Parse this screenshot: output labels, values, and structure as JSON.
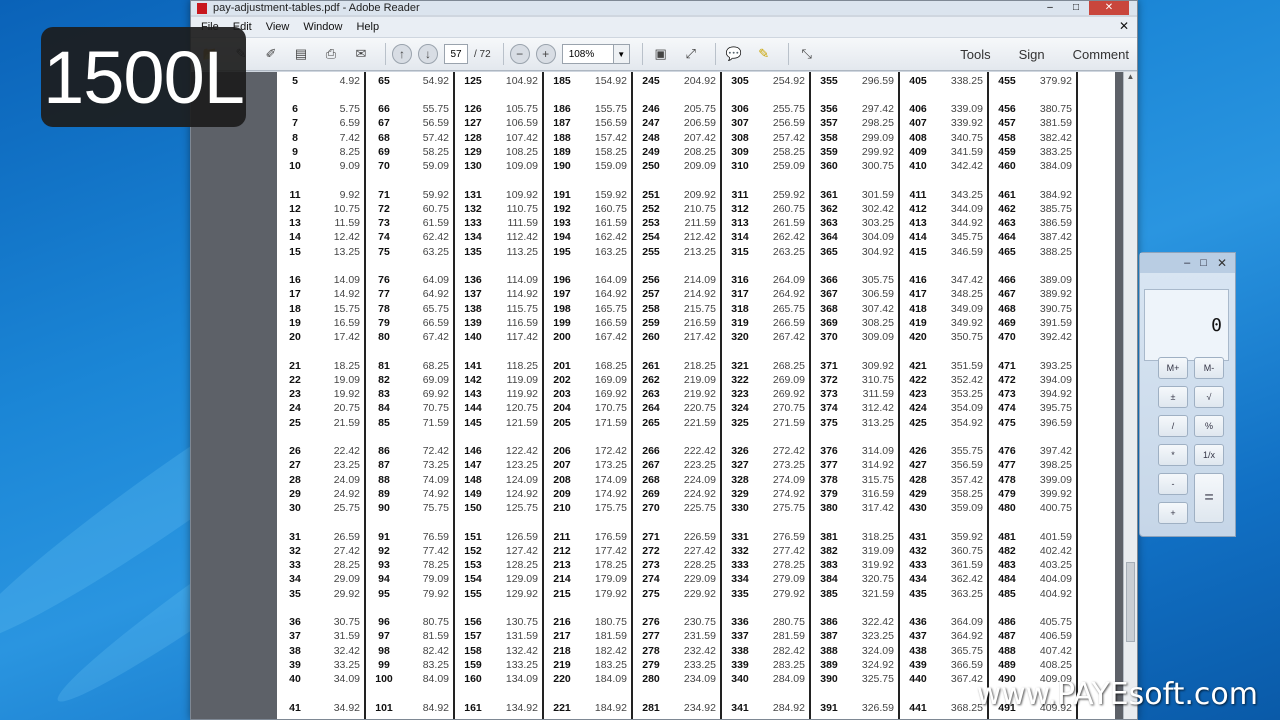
{
  "overlay": {
    "badge": "1500L",
    "watermark": "www.PAYEsoft.com"
  },
  "window": {
    "title": "pay-adjustment-tables.pdf - Adobe Reader"
  },
  "menu": [
    "File",
    "Edit",
    "View",
    "Window",
    "Help"
  ],
  "toolbar": {
    "page_current": "57",
    "page_total": "/ 72",
    "zoom": "108%",
    "right_buttons": [
      "Tools",
      "Sign",
      "Comment"
    ]
  },
  "table": {
    "columns": [
      [
        [
          "5",
          "4.92"
        ],
        [
          "6",
          "5.75"
        ],
        [
          "7",
          "6.59"
        ],
        [
          "8",
          "7.42"
        ],
        [
          "9",
          "8.25"
        ],
        [
          "10",
          "9.09"
        ],
        [
          "11",
          "9.92"
        ],
        [
          "12",
          "10.75"
        ],
        [
          "13",
          "11.59"
        ],
        [
          "14",
          "12.42"
        ],
        [
          "15",
          "13.25"
        ],
        [
          "16",
          "14.09"
        ],
        [
          "17",
          "14.92"
        ],
        [
          "18",
          "15.75"
        ],
        [
          "19",
          "16.59"
        ],
        [
          "20",
          "17.42"
        ],
        [
          "21",
          "18.25"
        ],
        [
          "22",
          "19.09"
        ],
        [
          "23",
          "19.92"
        ],
        [
          "24",
          "20.75"
        ],
        [
          "25",
          "21.59"
        ],
        [
          "26",
          "22.42"
        ],
        [
          "27",
          "23.25"
        ],
        [
          "28",
          "24.09"
        ],
        [
          "29",
          "24.92"
        ],
        [
          "30",
          "25.75"
        ],
        [
          "31",
          "26.59"
        ],
        [
          "32",
          "27.42"
        ],
        [
          "33",
          "28.25"
        ],
        [
          "34",
          "29.09"
        ],
        [
          "35",
          "29.92"
        ],
        [
          "36",
          "30.75"
        ],
        [
          "37",
          "31.59"
        ],
        [
          "38",
          "32.42"
        ],
        [
          "39",
          "33.25"
        ],
        [
          "40",
          "34.09"
        ],
        [
          "41",
          "34.92"
        ]
      ],
      [
        [
          "65",
          "54.92"
        ],
        [
          "66",
          "55.75"
        ],
        [
          "67",
          "56.59"
        ],
        [
          "68",
          "57.42"
        ],
        [
          "69",
          "58.25"
        ],
        [
          "70",
          "59.09"
        ],
        [
          "71",
          "59.92"
        ],
        [
          "72",
          "60.75"
        ],
        [
          "73",
          "61.59"
        ],
        [
          "74",
          "62.42"
        ],
        [
          "75",
          "63.25"
        ],
        [
          "76",
          "64.09"
        ],
        [
          "77",
          "64.92"
        ],
        [
          "78",
          "65.75"
        ],
        [
          "79",
          "66.59"
        ],
        [
          "80",
          "67.42"
        ],
        [
          "81",
          "68.25"
        ],
        [
          "82",
          "69.09"
        ],
        [
          "83",
          "69.92"
        ],
        [
          "84",
          "70.75"
        ],
        [
          "85",
          "71.59"
        ],
        [
          "86",
          "72.42"
        ],
        [
          "87",
          "73.25"
        ],
        [
          "88",
          "74.09"
        ],
        [
          "89",
          "74.92"
        ],
        [
          "90",
          "75.75"
        ],
        [
          "91",
          "76.59"
        ],
        [
          "92",
          "77.42"
        ],
        [
          "93",
          "78.25"
        ],
        [
          "94",
          "79.09"
        ],
        [
          "95",
          "79.92"
        ],
        [
          "96",
          "80.75"
        ],
        [
          "97",
          "81.59"
        ],
        [
          "98",
          "82.42"
        ],
        [
          "99",
          "83.25"
        ],
        [
          "100",
          "84.09"
        ],
        [
          "101",
          "84.92"
        ]
      ],
      [
        [
          "125",
          "104.92"
        ],
        [
          "126",
          "105.75"
        ],
        [
          "127",
          "106.59"
        ],
        [
          "128",
          "107.42"
        ],
        [
          "129",
          "108.25"
        ],
        [
          "130",
          "109.09"
        ],
        [
          "131",
          "109.92"
        ],
        [
          "132",
          "110.75"
        ],
        [
          "133",
          "111.59"
        ],
        [
          "134",
          "112.42"
        ],
        [
          "135",
          "113.25"
        ],
        [
          "136",
          "114.09"
        ],
        [
          "137",
          "114.92"
        ],
        [
          "138",
          "115.75"
        ],
        [
          "139",
          "116.59"
        ],
        [
          "140",
          "117.42"
        ],
        [
          "141",
          "118.25"
        ],
        [
          "142",
          "119.09"
        ],
        [
          "143",
          "119.92"
        ],
        [
          "144",
          "120.75"
        ],
        [
          "145",
          "121.59"
        ],
        [
          "146",
          "122.42"
        ],
        [
          "147",
          "123.25"
        ],
        [
          "148",
          "124.09"
        ],
        [
          "149",
          "124.92"
        ],
        [
          "150",
          "125.75"
        ],
        [
          "151",
          "126.59"
        ],
        [
          "152",
          "127.42"
        ],
        [
          "153",
          "128.25"
        ],
        [
          "154",
          "129.09"
        ],
        [
          "155",
          "129.92"
        ],
        [
          "156",
          "130.75"
        ],
        [
          "157",
          "131.59"
        ],
        [
          "158",
          "132.42"
        ],
        [
          "159",
          "133.25"
        ],
        [
          "160",
          "134.09"
        ],
        [
          "161",
          "134.92"
        ]
      ],
      [
        [
          "185",
          "154.92"
        ],
        [
          "186",
          "155.75"
        ],
        [
          "187",
          "156.59"
        ],
        [
          "188",
          "157.42"
        ],
        [
          "189",
          "158.25"
        ],
        [
          "190",
          "159.09"
        ],
        [
          "191",
          "159.92"
        ],
        [
          "192",
          "160.75"
        ],
        [
          "193",
          "161.59"
        ],
        [
          "194",
          "162.42"
        ],
        [
          "195",
          "163.25"
        ],
        [
          "196",
          "164.09"
        ],
        [
          "197",
          "164.92"
        ],
        [
          "198",
          "165.75"
        ],
        [
          "199",
          "166.59"
        ],
        [
          "200",
          "167.42"
        ],
        [
          "201",
          "168.25"
        ],
        [
          "202",
          "169.09"
        ],
        [
          "203",
          "169.92"
        ],
        [
          "204",
          "170.75"
        ],
        [
          "205",
          "171.59"
        ],
        [
          "206",
          "172.42"
        ],
        [
          "207",
          "173.25"
        ],
        [
          "208",
          "174.09"
        ],
        [
          "209",
          "174.92"
        ],
        [
          "210",
          "175.75"
        ],
        [
          "211",
          "176.59"
        ],
        [
          "212",
          "177.42"
        ],
        [
          "213",
          "178.25"
        ],
        [
          "214",
          "179.09"
        ],
        [
          "215",
          "179.92"
        ],
        [
          "216",
          "180.75"
        ],
        [
          "217",
          "181.59"
        ],
        [
          "218",
          "182.42"
        ],
        [
          "219",
          "183.25"
        ],
        [
          "220",
          "184.09"
        ],
        [
          "221",
          "184.92"
        ]
      ],
      [
        [
          "245",
          "204.92"
        ],
        [
          "246",
          "205.75"
        ],
        [
          "247",
          "206.59"
        ],
        [
          "248",
          "207.42"
        ],
        [
          "249",
          "208.25"
        ],
        [
          "250",
          "209.09"
        ],
        [
          "251",
          "209.92"
        ],
        [
          "252",
          "210.75"
        ],
        [
          "253",
          "211.59"
        ],
        [
          "254",
          "212.42"
        ],
        [
          "255",
          "213.25"
        ],
        [
          "256",
          "214.09"
        ],
        [
          "257",
          "214.92"
        ],
        [
          "258",
          "215.75"
        ],
        [
          "259",
          "216.59"
        ],
        [
          "260",
          "217.42"
        ],
        [
          "261",
          "218.25"
        ],
        [
          "262",
          "219.09"
        ],
        [
          "263",
          "219.92"
        ],
        [
          "264",
          "220.75"
        ],
        [
          "265",
          "221.59"
        ],
        [
          "266",
          "222.42"
        ],
        [
          "267",
          "223.25"
        ],
        [
          "268",
          "224.09"
        ],
        [
          "269",
          "224.92"
        ],
        [
          "270",
          "225.75"
        ],
        [
          "271",
          "226.59"
        ],
        [
          "272",
          "227.42"
        ],
        [
          "273",
          "228.25"
        ],
        [
          "274",
          "229.09"
        ],
        [
          "275",
          "229.92"
        ],
        [
          "276",
          "230.75"
        ],
        [
          "277",
          "231.59"
        ],
        [
          "278",
          "232.42"
        ],
        [
          "279",
          "233.25"
        ],
        [
          "280",
          "234.09"
        ],
        [
          "281",
          "234.92"
        ]
      ],
      [
        [
          "305",
          "254.92"
        ],
        [
          "306",
          "255.75"
        ],
        [
          "307",
          "256.59"
        ],
        [
          "308",
          "257.42"
        ],
        [
          "309",
          "258.25"
        ],
        [
          "310",
          "259.09"
        ],
        [
          "311",
          "259.92"
        ],
        [
          "312",
          "260.75"
        ],
        [
          "313",
          "261.59"
        ],
        [
          "314",
          "262.42"
        ],
        [
          "315",
          "263.25"
        ],
        [
          "316",
          "264.09"
        ],
        [
          "317",
          "264.92"
        ],
        [
          "318",
          "265.75"
        ],
        [
          "319",
          "266.59"
        ],
        [
          "320",
          "267.42"
        ],
        [
          "321",
          "268.25"
        ],
        [
          "322",
          "269.09"
        ],
        [
          "323",
          "269.92"
        ],
        [
          "324",
          "270.75"
        ],
        [
          "325",
          "271.59"
        ],
        [
          "326",
          "272.42"
        ],
        [
          "327",
          "273.25"
        ],
        [
          "328",
          "274.09"
        ],
        [
          "329",
          "274.92"
        ],
        [
          "330",
          "275.75"
        ],
        [
          "331",
          "276.59"
        ],
        [
          "332",
          "277.42"
        ],
        [
          "333",
          "278.25"
        ],
        [
          "334",
          "279.09"
        ],
        [
          "335",
          "279.92"
        ],
        [
          "336",
          "280.75"
        ],
        [
          "337",
          "281.59"
        ],
        [
          "338",
          "282.42"
        ],
        [
          "339",
          "283.25"
        ],
        [
          "340",
          "284.09"
        ],
        [
          "341",
          "284.92"
        ]
      ],
      [
        [
          "355",
          "296.59"
        ],
        [
          "356",
          "297.42"
        ],
        [
          "357",
          "298.25"
        ],
        [
          "358",
          "299.09"
        ],
        [
          "359",
          "299.92"
        ],
        [
          "360",
          "300.75"
        ],
        [
          "361",
          "301.59"
        ],
        [
          "362",
          "302.42"
        ],
        [
          "363",
          "303.25"
        ],
        [
          "364",
          "304.09"
        ],
        [
          "365",
          "304.92"
        ],
        [
          "366",
          "305.75"
        ],
        [
          "367",
          "306.59"
        ],
        [
          "368",
          "307.42"
        ],
        [
          "369",
          "308.25"
        ],
        [
          "370",
          "309.09"
        ],
        [
          "371",
          "309.92"
        ],
        [
          "372",
          "310.75"
        ],
        [
          "373",
          "311.59"
        ],
        [
          "374",
          "312.42"
        ],
        [
          "375",
          "313.25"
        ],
        [
          "376",
          "314.09"
        ],
        [
          "377",
          "314.92"
        ],
        [
          "378",
          "315.75"
        ],
        [
          "379",
          "316.59"
        ],
        [
          "380",
          "317.42"
        ],
        [
          "381",
          "318.25"
        ],
        [
          "382",
          "319.09"
        ],
        [
          "383",
          "319.92"
        ],
        [
          "384",
          "320.75"
        ],
        [
          "385",
          "321.59"
        ],
        [
          "386",
          "322.42"
        ],
        [
          "387",
          "323.25"
        ],
        [
          "388",
          "324.09"
        ],
        [
          "389",
          "324.92"
        ],
        [
          "390",
          "325.75"
        ],
        [
          "391",
          "326.59"
        ]
      ],
      [
        [
          "405",
          "338.25"
        ],
        [
          "406",
          "339.09"
        ],
        [
          "407",
          "339.92"
        ],
        [
          "408",
          "340.75"
        ],
        [
          "409",
          "341.59"
        ],
        [
          "410",
          "342.42"
        ],
        [
          "411",
          "343.25"
        ],
        [
          "412",
          "344.09"
        ],
        [
          "413",
          "344.92"
        ],
        [
          "414",
          "345.75"
        ],
        [
          "415",
          "346.59"
        ],
        [
          "416",
          "347.42"
        ],
        [
          "417",
          "348.25"
        ],
        [
          "418",
          "349.09"
        ],
        [
          "419",
          "349.92"
        ],
        [
          "420",
          "350.75"
        ],
        [
          "421",
          "351.59"
        ],
        [
          "422",
          "352.42"
        ],
        [
          "423",
          "353.25"
        ],
        [
          "424",
          "354.09"
        ],
        [
          "425",
          "354.92"
        ],
        [
          "426",
          "355.75"
        ],
        [
          "427",
          "356.59"
        ],
        [
          "428",
          "357.42"
        ],
        [
          "429",
          "358.25"
        ],
        [
          "430",
          "359.09"
        ],
        [
          "431",
          "359.92"
        ],
        [
          "432",
          "360.75"
        ],
        [
          "433",
          "361.59"
        ],
        [
          "434",
          "362.42"
        ],
        [
          "435",
          "363.25"
        ],
        [
          "436",
          "364.09"
        ],
        [
          "437",
          "364.92"
        ],
        [
          "438",
          "365.75"
        ],
        [
          "439",
          "366.59"
        ],
        [
          "440",
          "367.42"
        ],
        [
          "441",
          "368.25"
        ]
      ],
      [
        [
          "455",
          "379.92"
        ],
        [
          "456",
          "380.75"
        ],
        [
          "457",
          "381.59"
        ],
        [
          "458",
          "382.42"
        ],
        [
          "459",
          "383.25"
        ],
        [
          "460",
          "384.09"
        ],
        [
          "461",
          "384.92"
        ],
        [
          "462",
          "385.75"
        ],
        [
          "463",
          "386.59"
        ],
        [
          "464",
          "387.42"
        ],
        [
          "465",
          "388.25"
        ],
        [
          "466",
          "389.09"
        ],
        [
          "467",
          "389.92"
        ],
        [
          "468",
          "390.75"
        ],
        [
          "469",
          "391.59"
        ],
        [
          "470",
          "392.42"
        ],
        [
          "471",
          "393.25"
        ],
        [
          "472",
          "394.09"
        ],
        [
          "473",
          "394.92"
        ],
        [
          "474",
          "395.75"
        ],
        [
          "475",
          "396.59"
        ],
        [
          "476",
          "397.42"
        ],
        [
          "477",
          "398.25"
        ],
        [
          "478",
          "399.09"
        ],
        [
          "479",
          "399.92"
        ],
        [
          "480",
          "400.75"
        ],
        [
          "481",
          "401.59"
        ],
        [
          "482",
          "402.42"
        ],
        [
          "483",
          "403.25"
        ],
        [
          "484",
          "404.09"
        ],
        [
          "485",
          "404.92"
        ],
        [
          "486",
          "405.75"
        ],
        [
          "487",
          "406.59"
        ],
        [
          "488",
          "407.42"
        ],
        [
          "489",
          "408.25"
        ],
        [
          "490",
          "409.09"
        ],
        [
          "491",
          "409.92"
        ]
      ]
    ]
  },
  "calculator": {
    "display": "0",
    "keys": [
      "M+",
      "M-",
      "±",
      "√",
      "/",
      "%",
      "*",
      "1/x",
      "-",
      "+",
      "="
    ]
  }
}
